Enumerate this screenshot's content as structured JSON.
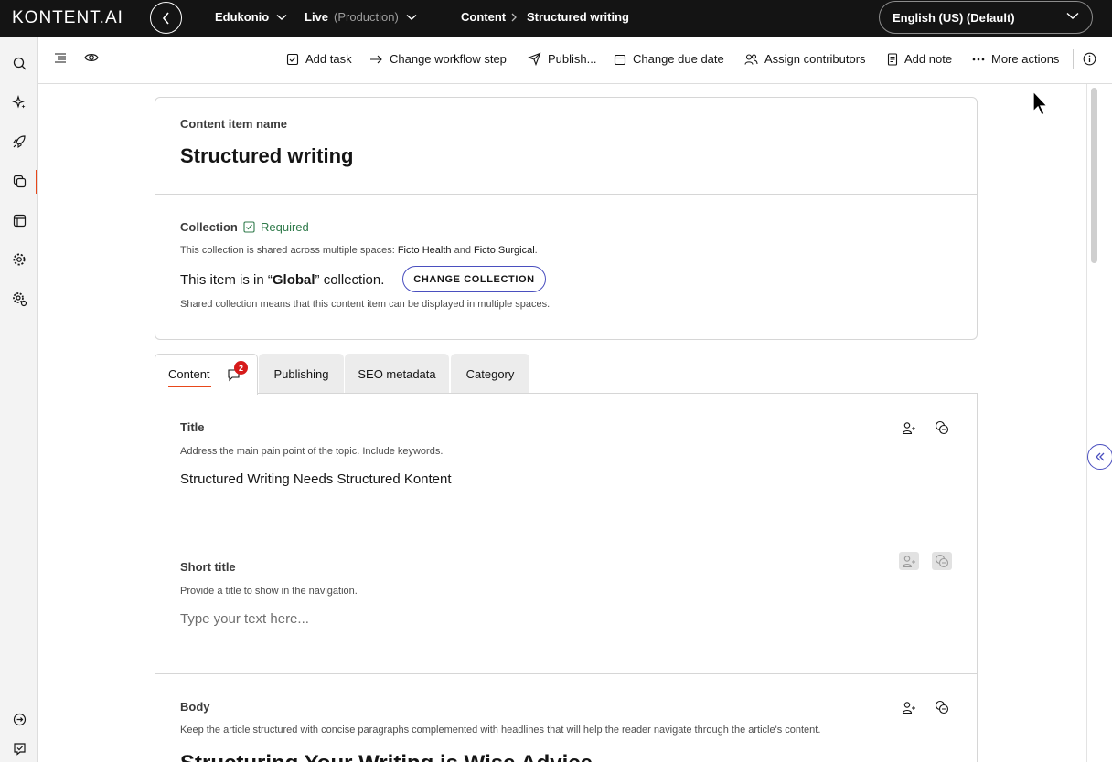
{
  "topbar": {
    "logo": "KONTENT.AI",
    "project": "Edukonio",
    "environment": "Live",
    "environment_sub": "(Production)",
    "breadcrumb_section": "Content",
    "breadcrumb_sep": ">",
    "breadcrumb_current": "Structured writing",
    "language": "English (US) (Default)"
  },
  "leftnav": {
    "items": [
      "search-icon",
      "sparkle-icon",
      "rocket-icon",
      "content-icon",
      "layout-icon",
      "settings-icon",
      "environment-settings-icon"
    ],
    "bottom": [
      "sign-out-icon",
      "feedback-icon"
    ]
  },
  "toolbar": {
    "add_task": "Add task",
    "change_workflow": "Change workflow step",
    "publish": "Publish...",
    "change_due_date": "Change due date",
    "assign_contributors": "Assign contributors",
    "add_note": "Add note",
    "more_actions": "More actions"
  },
  "item": {
    "name_label": "Content item name",
    "name": "Structured writing"
  },
  "collection": {
    "label": "Collection",
    "required": "Required",
    "shared_prefix": "This collection is shared across multiple spaces: ",
    "space_1": "Ficto Health",
    "and": " and ",
    "space_2": "Ficto Surgical",
    "period": ".",
    "line_prefix": "This item is in “",
    "collection_name": "Global",
    "line_suffix": "” collection.",
    "change_button": "CHANGE COLLECTION",
    "note": "Shared collection means that this content item can be displayed in multiple spaces."
  },
  "tabs": [
    {
      "label": "Content",
      "comment_count": "2"
    },
    {
      "label": "Publishing"
    },
    {
      "label": "SEO metadata"
    },
    {
      "label": "Category"
    }
  ],
  "elements": {
    "title": {
      "label": "Title",
      "hint": "Address the main pain point of the topic. Include keywords.",
      "value": "Structured Writing Needs Structured Kontent"
    },
    "short_title": {
      "label": "Short title",
      "hint": "Provide a title to show in the navigation.",
      "placeholder": "Type your text here..."
    },
    "body": {
      "label": "Body",
      "hint": "Keep the article structured with concise paragraphs complemented with headlines that will help the reader navigate through the article's content.",
      "heading": "Structuring Your Writing is Wise Advice"
    }
  }
}
